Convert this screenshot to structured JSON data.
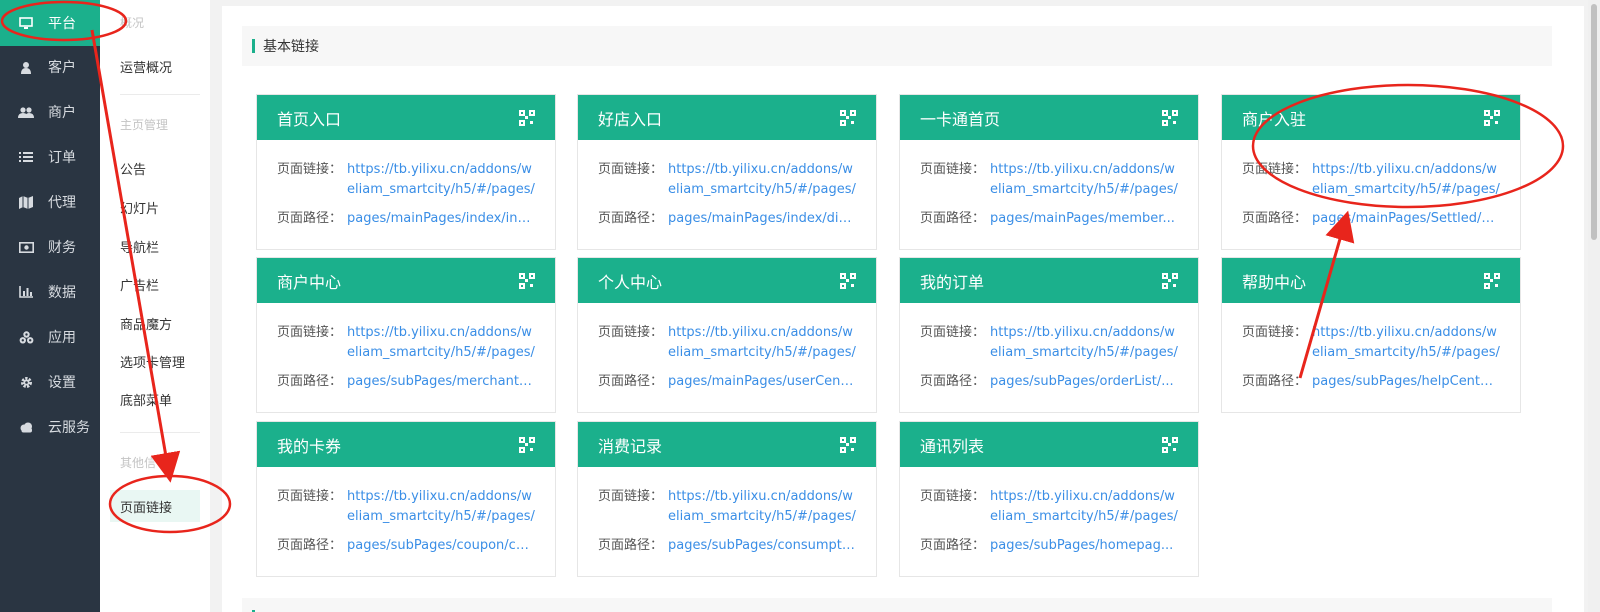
{
  "nav": {
    "items": [
      {
        "label": "平台",
        "icon": "monitor-icon",
        "active": true
      },
      {
        "label": "客户",
        "icon": "user-icon"
      },
      {
        "label": "商户",
        "icon": "users-icon"
      },
      {
        "label": "订单",
        "icon": "list-icon"
      },
      {
        "label": "代理",
        "icon": "map-icon"
      },
      {
        "label": "财务",
        "icon": "money-icon"
      },
      {
        "label": "数据",
        "icon": "bar-chart-icon"
      },
      {
        "label": "应用",
        "icon": "apps-icon"
      },
      {
        "label": "设置",
        "icon": "gear-icon"
      },
      {
        "label": "云服务",
        "icon": "cloud-icon"
      }
    ]
  },
  "submenu": {
    "group1": "概况",
    "overview": "运营概况",
    "group2": "主页管理",
    "items": [
      "公告",
      "幻灯片",
      "导航栏",
      "广告栏",
      "商品魔方",
      "选项卡管理",
      "底部菜单"
    ],
    "group3": "其他信",
    "active": "页面链接"
  },
  "section": {
    "title": "基本链接"
  },
  "labels": {
    "link": "页面链接：",
    "path": "页面路径："
  },
  "cards": [
    {
      "title": "首页入口",
      "link": "https://tb.yilixu.cn/addons/weliam_smartcity/h5/#/pages/m...",
      "path": "pages/mainPages/index/index"
    },
    {
      "title": "好店入口",
      "link": "https://tb.yilixu.cn/addons/weliam_smartcity/h5/#/pages/m...",
      "path": "pages/mainPages/index/diy..."
    },
    {
      "title": "一卡通首页",
      "link": "https://tb.yilixu.cn/addons/weliam_smartcity/h5/#/pages/m...",
      "path": "pages/mainPages/member..."
    },
    {
      "title": "商户入驻",
      "link": "https://tb.yilixu.cn/addons/weliam_smartcity/h5/#/pages/m...",
      "path": "pages/mainPages/Settled/S..."
    },
    {
      "title": "商户中心",
      "link": "https://tb.yilixu.cn/addons/weliam_smartcity/h5/#/pages/s...",
      "path": "pages/subPages/merchant/..."
    },
    {
      "title": "个人中心",
      "link": "https://tb.yilixu.cn/addons/weliam_smartcity/h5/#/pages/m...",
      "path": "pages/mainPages/userCent..."
    },
    {
      "title": "我的订单",
      "link": "https://tb.yilixu.cn/addons/weliam_smartcity/h5/#/pages/s...",
      "path": "pages/subPages/orderList/..."
    },
    {
      "title": "帮助中心",
      "link": "https://tb.yilixu.cn/addons/weliam_smartcity/h5/#/pages/s...",
      "path": "pages/subPages/helpCente..."
    },
    {
      "title": "我的卡券",
      "link": "https://tb.yilixu.cn/addons/weliam_smartcity/h5/#/pages/s...",
      "path": "pages/subPages/coupon/co..."
    },
    {
      "title": "消费记录",
      "link": "https://tb.yilixu.cn/addons/weliam_smartcity/h5/#/pages/s...",
      "path": "pages/subPages/consumpti..."
    },
    {
      "title": "通讯列表",
      "link": "https://tb.yilixu.cn/addons/weliam_smartcity/h5/#/pages/s...",
      "path": "pages/subPages/homepag..."
    }
  ],
  "colors": {
    "accent": "#1bb08c",
    "sidebar": "#2a3542",
    "link": "#3a8ee6",
    "annotation": "#e8251c"
  }
}
